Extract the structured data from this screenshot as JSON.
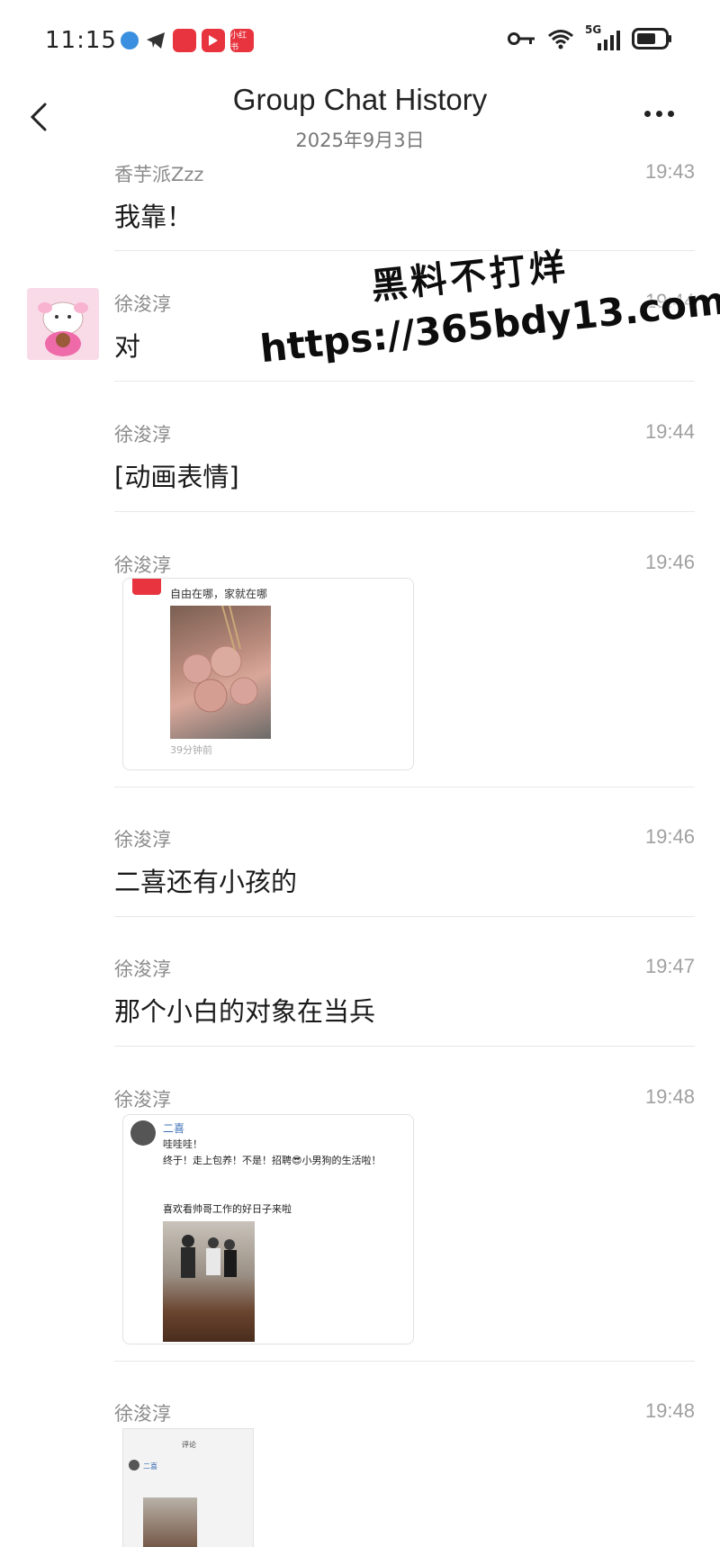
{
  "status": {
    "time": "11:15",
    "network": "5G",
    "app_icons": [
      "bluebird-icon",
      "telegram-icon",
      "redbook-app-icon",
      "video-app-icon",
      "xiaohongshu-icon"
    ],
    "xiaohongshu_label": "小红书"
  },
  "header": {
    "title": "Group Chat History",
    "date": "2025年9月3日"
  },
  "messages": [
    {
      "sender": "香芋派Zzz",
      "time": "19:43",
      "text": "我靠！"
    },
    {
      "sender": "徐浚淳",
      "time": "19:44",
      "text": "对"
    },
    {
      "sender": "徐浚淳",
      "time": "19:44",
      "text": "[动画表情]"
    },
    {
      "sender": "徐浚淳",
      "time": "19:46",
      "card_caption": "自由在哪，家就在哪",
      "card_footer": "39分钟前"
    },
    {
      "sender": "徐浚淳",
      "time": "19:46",
      "text": "二喜还有小孩的"
    },
    {
      "sender": "徐浚淳",
      "time": "19:47",
      "text": "那个小白的对象在当兵"
    },
    {
      "sender": "徐浚淳",
      "time": "19:48",
      "card_author": "二喜",
      "card_line1": "哇哇哇！",
      "card_line2": "终于！走上包养！不是！招聘😎小男狗的生活啦！",
      "card_line3": "喜欢看帅哥工作的好日子来啦"
    },
    {
      "sender": "徐浚淳",
      "time": "19:48",
      "thumb_header": "评论",
      "thumb_author": "二喜"
    }
  ],
  "watermark": {
    "line1": "黑料不打烊",
    "line2": "https://365bdy13.com"
  },
  "colors": {
    "accent_red": "#e8343f",
    "divider": "#e8e8e8",
    "meta_gray": "#8a8a8a"
  }
}
